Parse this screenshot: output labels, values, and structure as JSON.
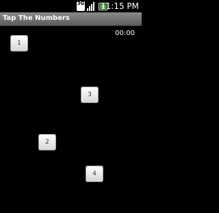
{
  "status_bar": {
    "network_type": "3G",
    "network_icon": "mobile-data-icon",
    "signal_icon": "signal-strength-icon",
    "battery_icon": "battery-charging-icon",
    "time": "11:15 PM"
  },
  "app": {
    "title": "Tap The Numbers"
  },
  "game": {
    "timer": "00:00",
    "buttons": [
      {
        "label": "1"
      },
      {
        "label": "3"
      },
      {
        "label": "2"
      },
      {
        "label": "4"
      }
    ]
  },
  "colors": {
    "background": "#000000",
    "title_bar": "#6e6e6e",
    "button_face": "#e6e6e6",
    "text": "#ffffff"
  }
}
